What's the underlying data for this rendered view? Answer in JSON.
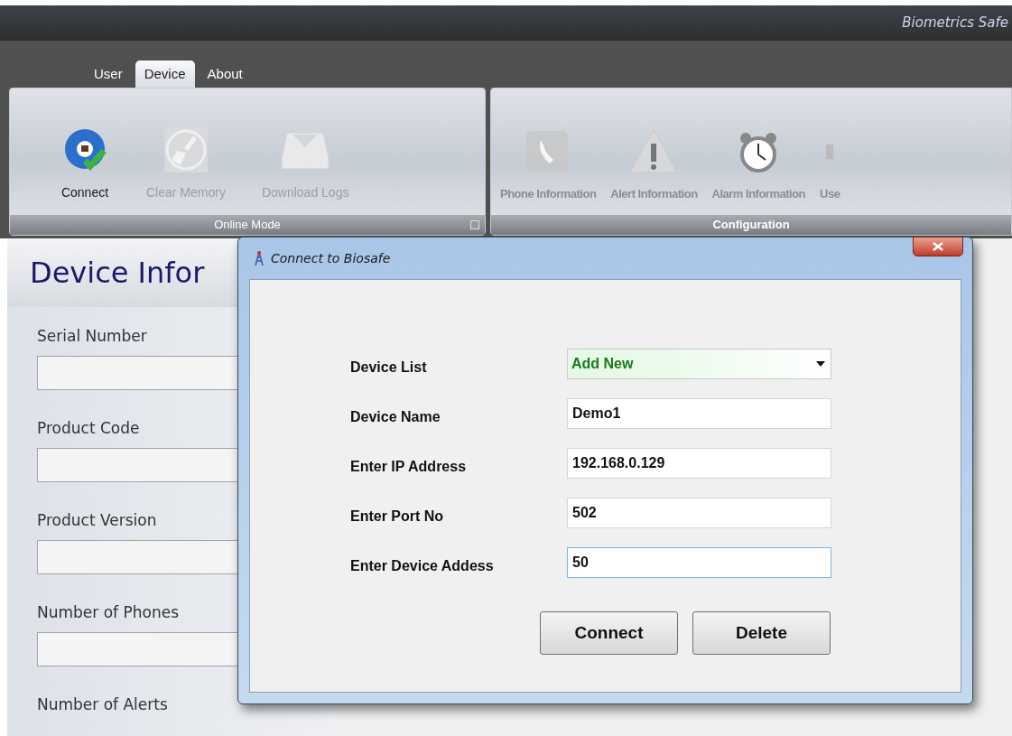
{
  "window": {
    "title": "Biometrics Safe"
  },
  "tabs": [
    {
      "label": "User",
      "selected": false
    },
    {
      "label": "Device",
      "selected": true
    },
    {
      "label": "About",
      "selected": false
    }
  ],
  "ribbon_groups": [
    {
      "caption": "Online Mode",
      "items": [
        {
          "label": "Connect",
          "disabled": false
        },
        {
          "label": "Clear Memory",
          "disabled": true
        },
        {
          "label": "Download Logs",
          "disabled": true
        }
      ]
    },
    {
      "caption": "Configuration",
      "items": [
        {
          "label": "Phone Information",
          "disabled": true
        },
        {
          "label": "Alert Information",
          "disabled": true
        },
        {
          "label": "Alarm Information",
          "disabled": true
        },
        {
          "label": "Use",
          "disabled": true
        }
      ]
    }
  ],
  "panel": {
    "heading": "Device Infor",
    "fields": [
      {
        "label": "Serial Number"
      },
      {
        "label": "Product Code"
      },
      {
        "label": "Product Version"
      },
      {
        "label": "Number of Phones"
      },
      {
        "label": "Number of Alerts"
      }
    ]
  },
  "dialog": {
    "title": "Connect to Biosafe",
    "rows": [
      {
        "kind": "dropdown",
        "label": "Device List",
        "value": "Add New"
      },
      {
        "kind": "text",
        "label": "Device Name",
        "value": "Demo1",
        "focused": false
      },
      {
        "kind": "text",
        "label": "Enter IP Address",
        "value": "192.168.0.129",
        "focused": false
      },
      {
        "kind": "text",
        "label": "Enter Port No",
        "value": "502",
        "focused": false
      },
      {
        "kind": "text",
        "label": "Enter Device Addess",
        "value": "50",
        "focused": true
      }
    ],
    "buttons": [
      "Connect",
      "Delete"
    ]
  }
}
